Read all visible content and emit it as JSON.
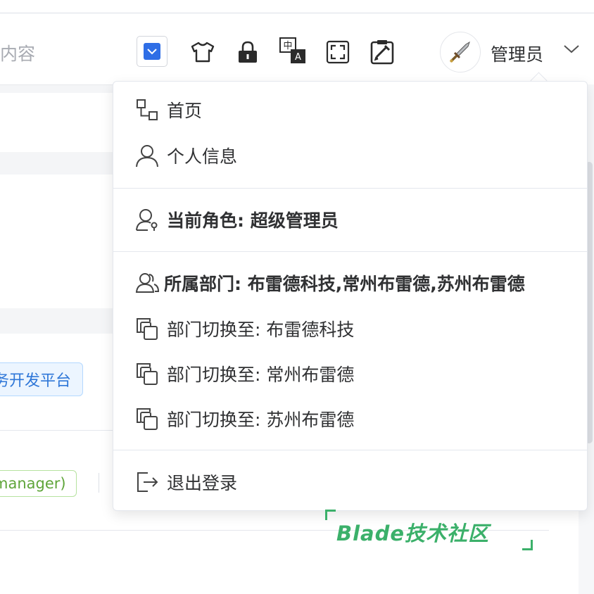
{
  "header": {
    "search_partial": "内容",
    "username": "管理员"
  },
  "tools": [
    {
      "icon": "checkbox-icon"
    },
    {
      "icon": "tshirt-icon"
    },
    {
      "icon": "lock-icon"
    },
    {
      "icon": "translate-icon",
      "top_char": "中",
      "bottom_char": "A"
    },
    {
      "icon": "fullscreen-icon"
    },
    {
      "icon": "clipboard-tool-icon"
    }
  ],
  "background": {
    "tag_blue": "务开发平台",
    "tag_green": "manager)"
  },
  "menu": {
    "home": "首页",
    "profile": "个人信息",
    "role": "当前角色: 超级管理员",
    "dept": "所属部门: 布雷德科技,常州布雷德,苏州布雷德",
    "switch1": "部门切换至: 布雷德科技",
    "switch2": "部门切换至: 常州布雷德",
    "switch3": "部门切换至: 苏州布雷德",
    "logout": "退出登录"
  },
  "watermark": "Blade技术社区",
  "colors": {
    "accent": "#2f77d8",
    "watermark": "#3bb06a",
    "tag_green": "#5fa53a"
  }
}
